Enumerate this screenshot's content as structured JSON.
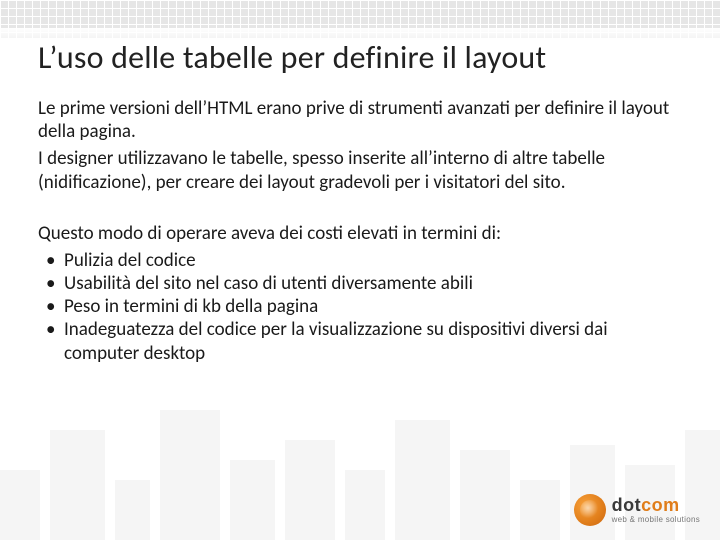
{
  "slide": {
    "title": "L’uso delle tabelle per definire il layout",
    "para1": "Le prime versioni dell’HTML erano prive di strumenti avanzati per definire il layout della pagina.",
    "para2": "I designer utilizzavano le tabelle, spesso inserite all’interno di altre tabelle (nidificazione), per creare dei layout gradevoli per i visitatori del sito.",
    "para3": "Questo modo di operare aveva dei costi elevati in termini di:",
    "bullets": [
      "Pulizia del codice",
      "Usabilità del sito nel caso di utenti diversamente abili",
      "Peso in termini di kb della pagina",
      "Inadeguatezza del codice per la visualizzazione su dispositivi diversi dai computer desktop"
    ]
  },
  "logo": {
    "name_main": "dot",
    "name_accent": "com",
    "tagline": "web & mobile solutions"
  }
}
